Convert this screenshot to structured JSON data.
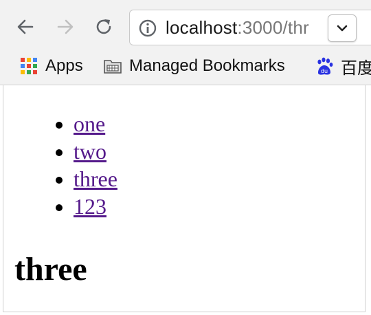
{
  "browser": {
    "address_host": "localhost",
    "address_rest": ":3000/thr",
    "bookmarks": [
      {
        "label": "Apps",
        "icon": "apps-grid-icon"
      },
      {
        "label": "Managed Bookmarks",
        "icon": "folder-icon"
      },
      {
        "label": "百度",
        "icon": "baidu-paw-icon"
      }
    ]
  },
  "page": {
    "nav_links": [
      {
        "label": "one"
      },
      {
        "label": "two"
      },
      {
        "label": "three"
      },
      {
        "label": "123"
      }
    ],
    "heading": "three"
  },
  "colors": {
    "visited_link": "#551a8b",
    "chrome_bg": "#f2f2f2"
  }
}
